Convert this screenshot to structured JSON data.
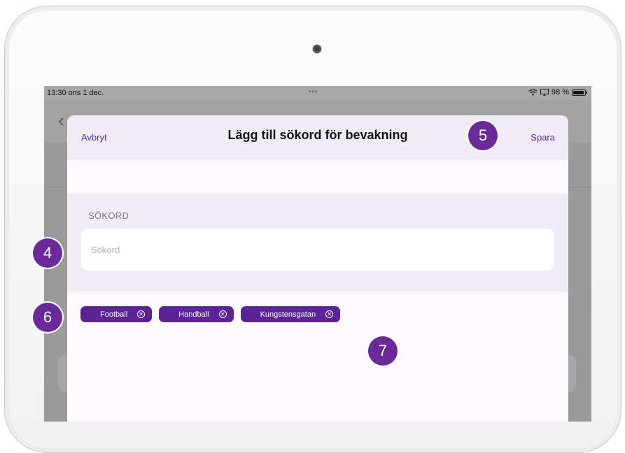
{
  "status_bar": {
    "time": "13:30",
    "date": "ons 1 dec.",
    "dots": "•••",
    "battery": "98 %"
  },
  "sheet": {
    "cancel_label": "Avbryt",
    "title": "Lägg till sökord för bevakning",
    "save_label": "Spara",
    "section_header": "SÖKORD",
    "search": {
      "placeholder": "Sökord",
      "value": ""
    },
    "chips": [
      {
        "label": "Football"
      },
      {
        "label": "Handball"
      },
      {
        "label": "Kungstensgatan"
      }
    ]
  },
  "badges": {
    "four": "4",
    "five": "5",
    "six": "6",
    "seven": "7"
  },
  "colors": {
    "accent": "#5b2396",
    "badge": "#6b2a9a",
    "header_bg": "#f0ecf6"
  }
}
